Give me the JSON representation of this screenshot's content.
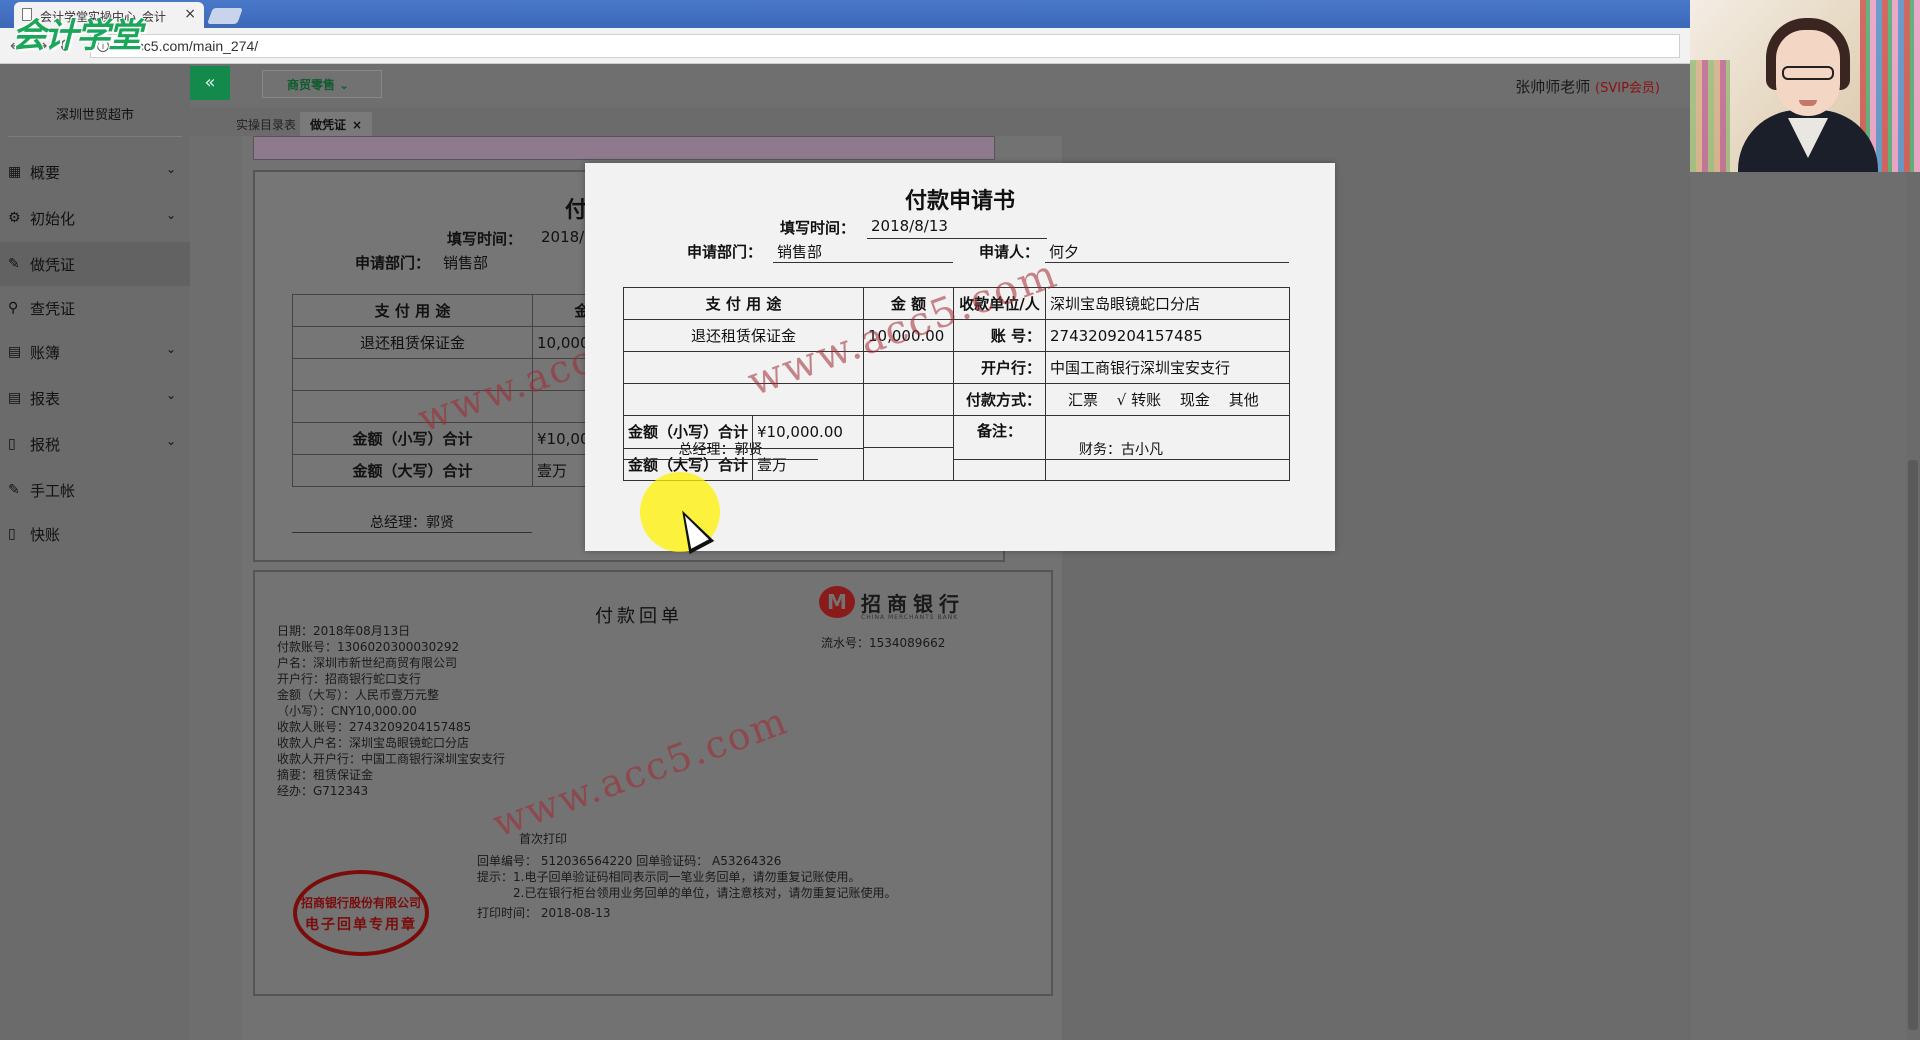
{
  "browser": {
    "tab_title": "会计学堂实操中心_会计",
    "tab_close": "×",
    "url": "lx.acc5.com/main_274/",
    "back": "←",
    "forward": "→",
    "reload": "C",
    "info": "i"
  },
  "logo": "会计学堂",
  "sidebar": {
    "company": "深圳世贸超市",
    "items": [
      {
        "label": "概要",
        "icon": "grid-icon",
        "glyph": "▦",
        "has_chevron": true
      },
      {
        "label": "初始化",
        "icon": "gear-icon",
        "glyph": "⚙",
        "has_chevron": true
      },
      {
        "label": "做凭证",
        "icon": "pen-icon",
        "glyph": "✎",
        "has_chevron": false
      },
      {
        "label": "查凭证",
        "icon": "search-icon",
        "glyph": "⚲",
        "has_chevron": false
      },
      {
        "label": "账簿",
        "icon": "book-icon",
        "glyph": "▤",
        "has_chevron": true
      },
      {
        "label": "报表",
        "icon": "report-icon",
        "glyph": "▤",
        "has_chevron": true
      },
      {
        "label": "报税",
        "icon": "file-icon",
        "glyph": "▯",
        "has_chevron": true
      },
      {
        "label": "手工帐",
        "icon": "pen-icon",
        "glyph": "✎",
        "has_chevron": false
      },
      {
        "label": "快账",
        "icon": "file-icon",
        "glyph": "▯",
        "has_chevron": false
      }
    ],
    "chevron": "⌄"
  },
  "topbar": {
    "collapse": "«",
    "module": "商贸零售 ⌄",
    "teacher": "张帅师老师",
    "vip": "(SVIP会员)"
  },
  "tabs": {
    "catalog": "实操目录表",
    "voucher": "做凭证",
    "close": "×"
  },
  "bg_form": {
    "title_fragment": "付",
    "fill_time_label": "填写时间：",
    "fill_time_value": "2018/8",
    "dept_label": "申请部门：",
    "dept_value": "销售部",
    "col_purpose": "支 付 用 途",
    "col_amount": "金 额",
    "row1_purpose": "退还租赁保证金",
    "row1_amount": "10,000",
    "small_total_label": "金额（小写）合计",
    "small_total_value": "¥10,000.00",
    "big_total_label": "金额（大写）合计",
    "big_total_value": "壹万",
    "manager": "总经理：郭贤"
  },
  "receipt": {
    "title": "付款回单",
    "bank_name": "招商银行",
    "bank_sub": "CHINA MERCHANTS BANK",
    "serial": "流水号：1534089662",
    "lines": [
      "日期：2018年08月13日",
      "付款账号：1306020300030292",
      "户名：深圳市新世纪商贸有限公司",
      "开户行：招商银行蛇口支行",
      "金额（大写）：人民币壹万元整",
      "（小写）：CNY10,000.00",
      "收款人账号：2743209204157485",
      "收款人户名：深圳宝岛眼镜蛇口分店",
      "收款人开户行：中国工商银行深圳宝安支行",
      "摘要：租赁保证金",
      "经办：G712343"
    ],
    "print_count": "首次打印",
    "receipt_no": "回单编号：  512036564220  回单验证码：  A53264326",
    "notice1": "提示：1.电子回单验证码相同表示同一笔业务回单，请勿重复记账使用。",
    "notice2": "2.已在银行柜台领用业务回单的单位，请注意核对，请勿重复记账使用。",
    "print_time": "打印时间：  2018-08-13",
    "stamp_line1": "招商银行股份有限公司",
    "stamp_line2": "电子回单专用章"
  },
  "watermark": "www.acc5.com",
  "modal": {
    "title": "付款申请书",
    "fill_time_label": "填写时间：",
    "fill_time_value": "2018/8/13",
    "dept_label": "申请部门：",
    "dept_value": "销售部",
    "applicant_label": "申请人：",
    "applicant_value": "何夕",
    "col_purpose": "支 付 用 途",
    "col_amount": "金 额",
    "payee_label": "收款单位/人",
    "payee_value": "深圳宝岛眼镜蛇口分店",
    "row1_purpose": "退还租赁保证金",
    "row1_amount": "10,000.00",
    "account_label": "账 号：",
    "account_value": "2743209204157485",
    "bank_label": "开户行：",
    "bank_value": "中国工商银行深圳宝安支行",
    "method_label": "付款方式：",
    "method_options": [
      "汇票",
      "√ 转账",
      "现金",
      "其他"
    ],
    "small_total_label": "金额（小写）合计",
    "small_total_value": "¥10,000.00",
    "big_total_label": "金额（大写）合计",
    "big_total_value": "壹万",
    "note_label": "备注：",
    "manager": "总经理：郭贤",
    "finance": "财务：古小凡"
  }
}
